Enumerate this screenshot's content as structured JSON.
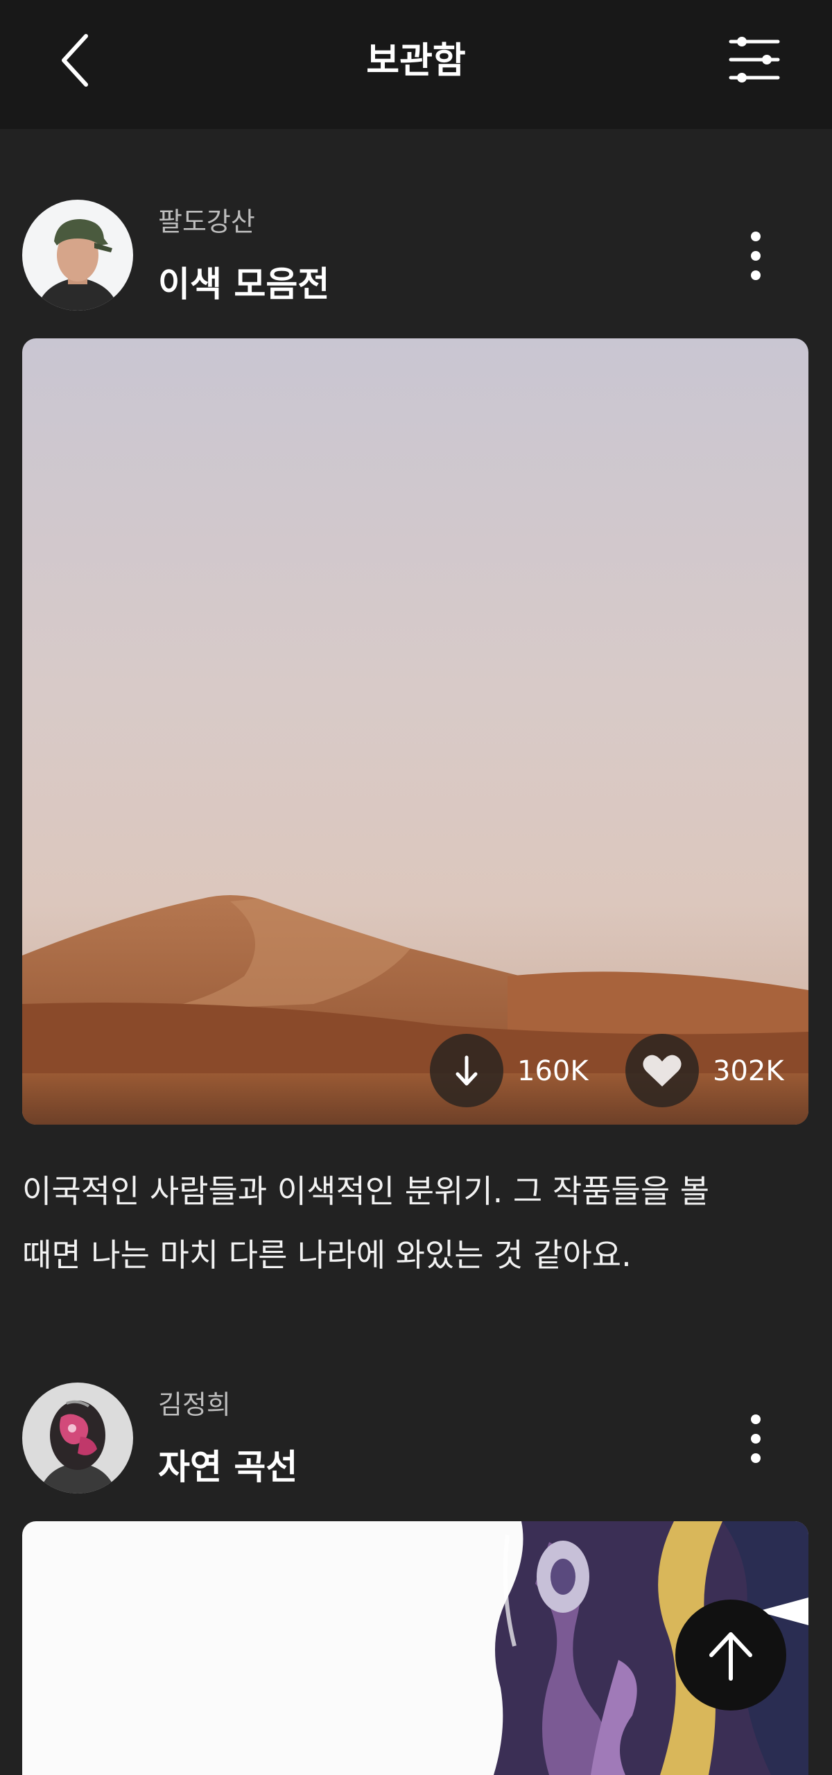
{
  "header": {
    "title": "보관함",
    "back_icon": "chevron-left-icon",
    "filter_icon": "sliders-icon"
  },
  "posts": [
    {
      "author": "팔도강산",
      "title": "이색 모음전",
      "downloads": "160K",
      "likes": "302K",
      "caption_line1": "이국적인 사람들과 이색적인 분위기. 그 작품들을 볼",
      "caption_line2": "때면 나는 마치 다른 나라에 와있는 것 같아요."
    },
    {
      "author": "김정희",
      "title": "자연 곡선"
    }
  ],
  "colors": {
    "background": "#222222",
    "header": "#181818",
    "secondary_text": "#bdbdbd"
  }
}
